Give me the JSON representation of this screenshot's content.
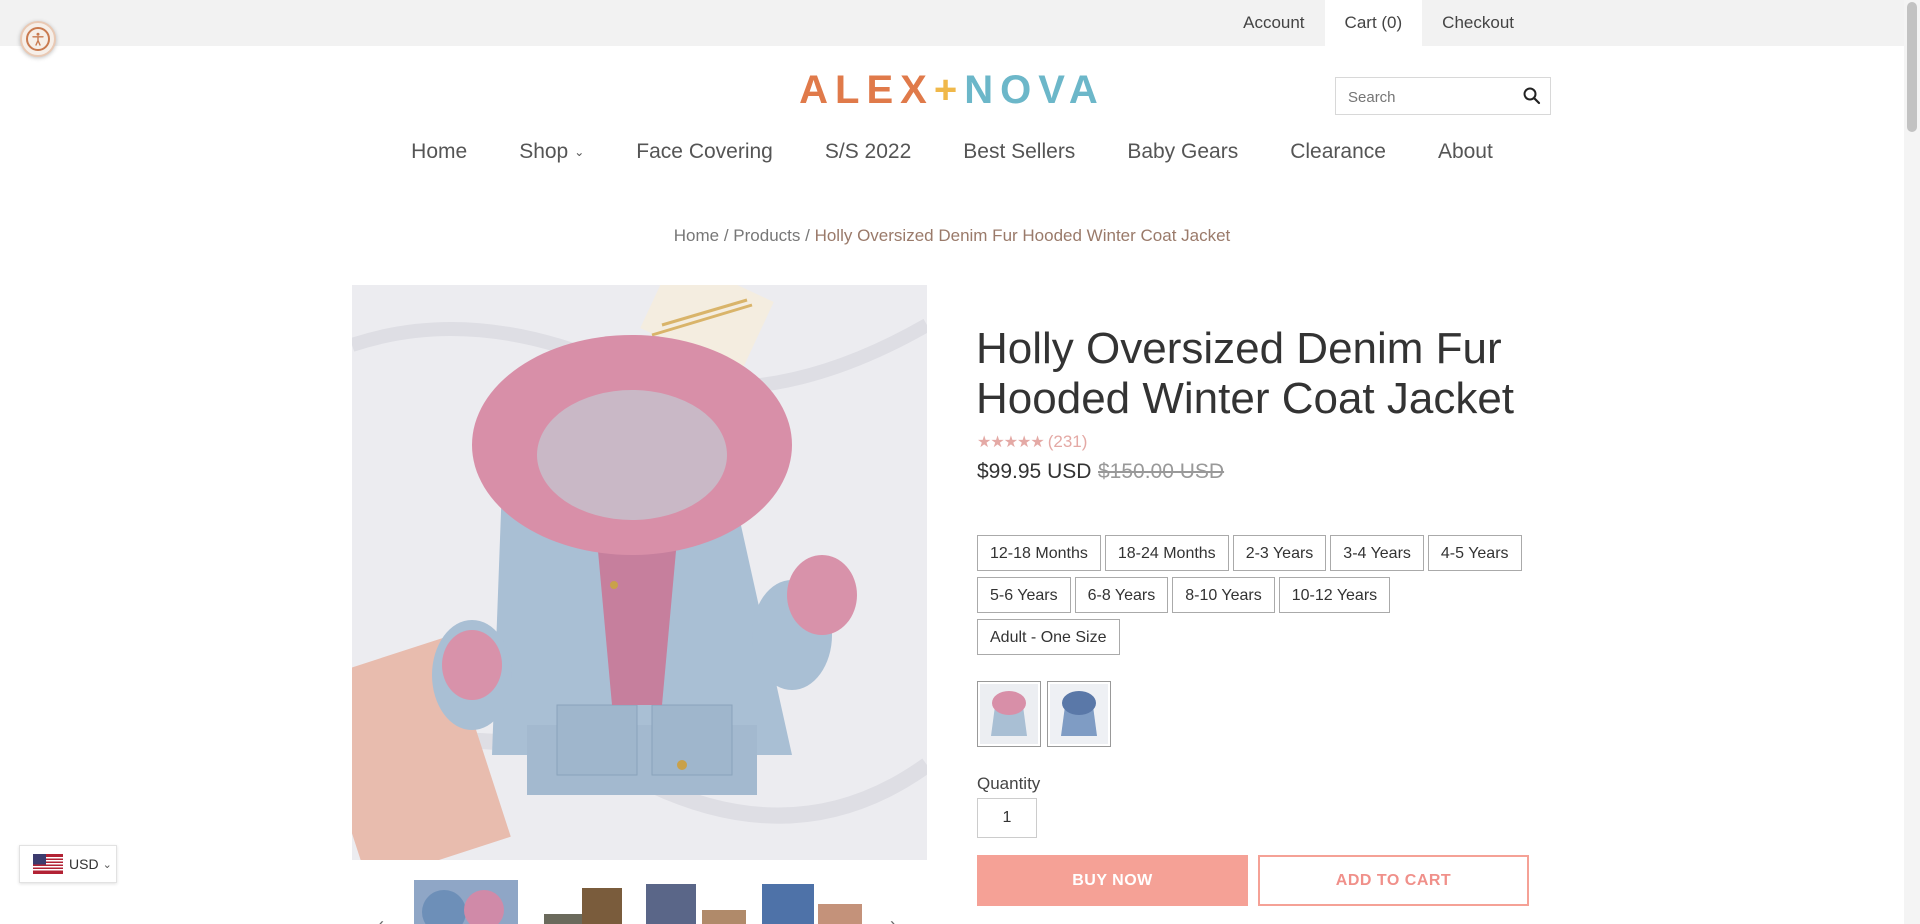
{
  "top_links": [
    {
      "label": "Account"
    },
    {
      "label": "Cart (0)"
    },
    {
      "label": "Checkout"
    }
  ],
  "logo": {
    "part1": "ALEX",
    "plus": "+",
    "part2": "NOVA",
    "colors": {
      "alex": "#e07a4a",
      "plus": "#f0b84a",
      "nova": "#6cb7c9"
    }
  },
  "search": {
    "placeholder": "Search",
    "icon": "search-icon"
  },
  "nav": [
    {
      "label": "Home"
    },
    {
      "label": "Shop",
      "has_dropdown": true
    },
    {
      "label": "Face Covering"
    },
    {
      "label": "S/S 2022"
    },
    {
      "label": "Best Sellers"
    },
    {
      "label": "Baby Gears"
    },
    {
      "label": "Clearance"
    },
    {
      "label": "About"
    }
  ],
  "breadcrumb": {
    "home": "Home",
    "sep": "/",
    "products": "Products",
    "current": "Holly Oversized Denim Fur Hooded Winter Coat Jacket"
  },
  "product": {
    "title": "Holly Oversized Denim Fur Hooded Winter Coat Jacket",
    "rating_stars": "★★★★★",
    "rating_count": "(231)",
    "price": "$99.95 USD",
    "compare_price": "$150.00 USD",
    "sizes": [
      "12-18 Months",
      "18-24 Months",
      "2-3 Years",
      "3-4 Years",
      "4-5 Years",
      "5-6 Years",
      "6-8 Years",
      "8-10 Years",
      "10-12 Years",
      "Adult - One Size"
    ],
    "swatches": [
      "pink-fur",
      "blue-fur"
    ],
    "quantity_label": "Quantity",
    "quantity": "1",
    "buy_now": "BUY NOW",
    "add_to_cart": "ADD TO CART"
  },
  "currency": {
    "code": "USD",
    "icon": "us-flag-icon"
  },
  "colors": {
    "accent": "#f5a196",
    "rating": "#e4a9a5"
  }
}
